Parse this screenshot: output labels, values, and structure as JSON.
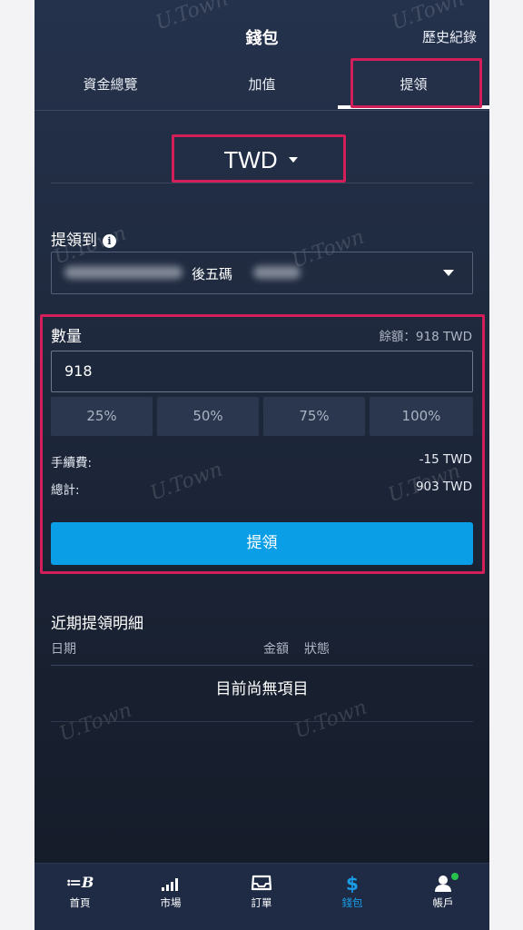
{
  "header": {
    "title": "錢包",
    "history_label": "歷史紀錄"
  },
  "tabs": [
    {
      "label": "資金總覽"
    },
    {
      "label": "加值"
    },
    {
      "label": "提領",
      "active": true
    }
  ],
  "currency": {
    "selected": "TWD"
  },
  "withdraw_to": {
    "label": "提領到",
    "account_suffix_text": "後五碼"
  },
  "amount": {
    "label": "數量",
    "balance": "餘額：918 TWD",
    "value": "918",
    "percent_buttons": [
      "25%",
      "50%",
      "75%",
      "100%"
    ]
  },
  "fees": {
    "fee_label": "手續費:",
    "fee_value": "-15 TWD",
    "total_label": "總計:",
    "total_value": "903 TWD"
  },
  "submit_label": "提領",
  "recent": {
    "title": "近期提領明細",
    "columns": {
      "date": "日期",
      "amount": "金額",
      "status": "狀態"
    },
    "empty_text": "目前尚無項目"
  },
  "watermark": "U.Town",
  "bottom_nav": [
    {
      "label": "首頁",
      "icon": "home-logo-icon"
    },
    {
      "label": "市場",
      "icon": "signal-bars-icon"
    },
    {
      "label": "訂單",
      "icon": "inbox-tray-icon"
    },
    {
      "label": "錢包",
      "icon": "dollar-icon",
      "active": true
    },
    {
      "label": "帳戶",
      "icon": "user-icon",
      "badge": "online-dot"
    }
  ],
  "colors": {
    "accent": "#0a9ee6",
    "highlight_box": "#d21f5a",
    "background": "#1d273a",
    "online": "#27c24c"
  }
}
